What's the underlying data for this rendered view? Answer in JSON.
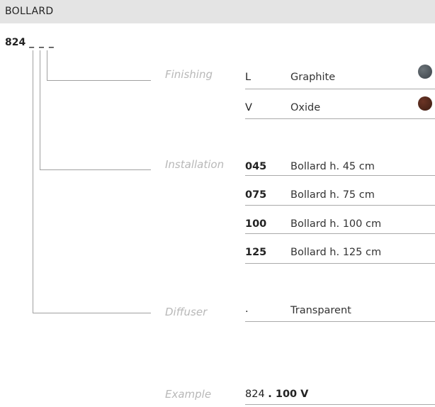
{
  "header": {
    "title": "BOLLARD"
  },
  "code": {
    "prefix": "824",
    "placeholder": "_ _ _"
  },
  "finishing": {
    "label": "Finishing",
    "options": [
      {
        "code": "L",
        "name": "Graphite",
        "color": "#4a5157"
      },
      {
        "code": "V",
        "name": "Oxide",
        "color": "#4a2418"
      }
    ]
  },
  "installation": {
    "label": "Installation",
    "options": [
      {
        "code": "045",
        "name": "Bollard h. 45 cm"
      },
      {
        "code": "075",
        "name": "Bollard h. 75 cm"
      },
      {
        "code": "100",
        "name": "Bollard h. 100 cm"
      },
      {
        "code": "125",
        "name": "Bollard h. 125 cm"
      }
    ]
  },
  "diffuser": {
    "label": "Diffuser",
    "options": [
      {
        "code": ".",
        "name": "Transparent"
      }
    ]
  },
  "example": {
    "label": "Example",
    "prefix": "824",
    "suffix": ". 100 V"
  }
}
